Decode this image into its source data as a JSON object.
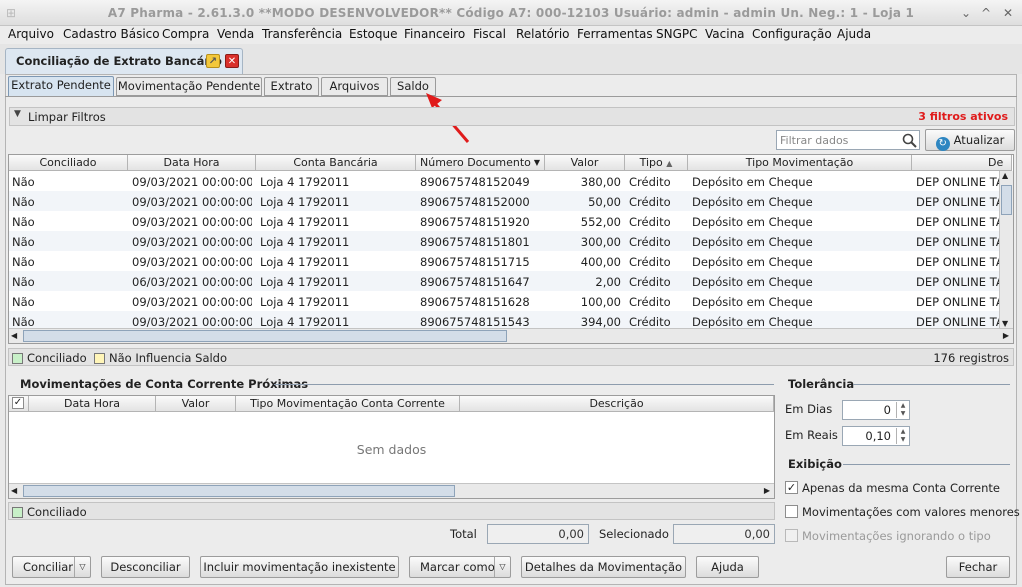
{
  "window": {
    "title": "A7 Pharma - 2.61.3.0   **MODO DESENVOLVEDOR**   Código A7: 000-12103   Usuário: admin - admin   Un. Neg.: 1 - Loja 1"
  },
  "menu": [
    "Arquivo",
    "Cadastro Básico",
    "Compra",
    "Venda",
    "Transferência",
    "Estoque",
    "Financeiro",
    "Fiscal",
    "Relatório",
    "Ferramentas",
    "SNGPC",
    "Vacina",
    "Configuração",
    "Ajuda"
  ],
  "doc_tab": {
    "label": "Conciliação de Extrato Bancário"
  },
  "subtabs": [
    "Extrato Pendente",
    "Movimentação Pendente",
    "Extrato",
    "Arquivos",
    "Saldo"
  ],
  "filter": {
    "label": "Limpar Filtros",
    "active_count": "3 filtros ativos",
    "search_placeholder": "Filtrar dados",
    "refresh_label": "Atualizar"
  },
  "table": {
    "columns": [
      "Conciliado",
      "Data Hora",
      "Conta Bancária",
      "Número Documento",
      "Valor",
      "Tipo",
      "Tipo Movimentação",
      "De"
    ],
    "rows": [
      [
        "Não",
        "09/03/2021 00:00:00",
        "Loja 4 1792011",
        "890675748152049",
        "380,00",
        "Crédito",
        "Depósito em Cheque",
        "DEP ONLINE TA"
      ],
      [
        "Não",
        "09/03/2021 00:00:00",
        "Loja 4 1792011",
        "890675748152000",
        "50,00",
        "Crédito",
        "Depósito em Cheque",
        "DEP ONLINE TA"
      ],
      [
        "Não",
        "09/03/2021 00:00:00",
        "Loja 4 1792011",
        "890675748151920",
        "552,00",
        "Crédito",
        "Depósito em Cheque",
        "DEP ONLINE TA"
      ],
      [
        "Não",
        "09/03/2021 00:00:00",
        "Loja 4 1792011",
        "890675748151801",
        "300,00",
        "Crédito",
        "Depósito em Cheque",
        "DEP ONLINE TA"
      ],
      [
        "Não",
        "09/03/2021 00:00:00",
        "Loja 4 1792011",
        "890675748151715",
        "400,00",
        "Crédito",
        "Depósito em Cheque",
        "DEP ONLINE TA"
      ],
      [
        "Não",
        "06/03/2021 00:00:00",
        "Loja 4 1792011",
        "890675748151647",
        "2,00",
        "Crédito",
        "Depósito em Cheque",
        "DEP ONLINE TA"
      ],
      [
        "Não",
        "09/03/2021 00:00:00",
        "Loja 4 1792011",
        "890675748151628",
        "100,00",
        "Crédito",
        "Depósito em Cheque",
        "DEP ONLINE TA"
      ],
      [
        "Não",
        "09/03/2021 00:00:00",
        "Loja 4 1792011",
        "890675748151543",
        "394,00",
        "Crédito",
        "Depósito em Cheque",
        "DEP ONLINE TA"
      ]
    ]
  },
  "legend": {
    "conciliado": "Conciliado",
    "nao_influencia": "Não Influencia Saldo",
    "records": "176 registros"
  },
  "proximas": {
    "title": "Movimentações de Conta Corrente Próximas",
    "columns": [
      "Data Hora",
      "Valor",
      "Tipo Movimentação Conta Corrente",
      "Descrição"
    ],
    "empty": "Sem dados",
    "legend": "Conciliado"
  },
  "tolerancia": {
    "title": "Tolerância",
    "dias_label": "Em Dias",
    "dias_value": "0",
    "reais_label": "Em Reais",
    "reais_value": "0,10"
  },
  "exibicao": {
    "title": "Exibição",
    "opt1": "Apenas da mesma Conta Corrente",
    "opt2": "Movimentações com valores menores",
    "opt3": "Movimentações ignorando o tipo"
  },
  "totals": {
    "total_label": "Total",
    "total_value": "0,00",
    "selecionado_label": "Selecionado",
    "selecionado_value": "0,00"
  },
  "buttons": {
    "conciliar": "Conciliar",
    "desconciliar": "Desconciliar",
    "incluir": "Incluir movimentação inexistente",
    "marcar": "Marcar como",
    "detalhes": "Detalhes da Movimentação",
    "ajuda": "Ajuda",
    "fechar": "Fechar"
  },
  "colors": {
    "accent": "#2e86c1",
    "alert": "#e01b1b",
    "conciliado_swatch": "#c8f0c8",
    "nao_influencia_swatch": "#fff5b8"
  }
}
